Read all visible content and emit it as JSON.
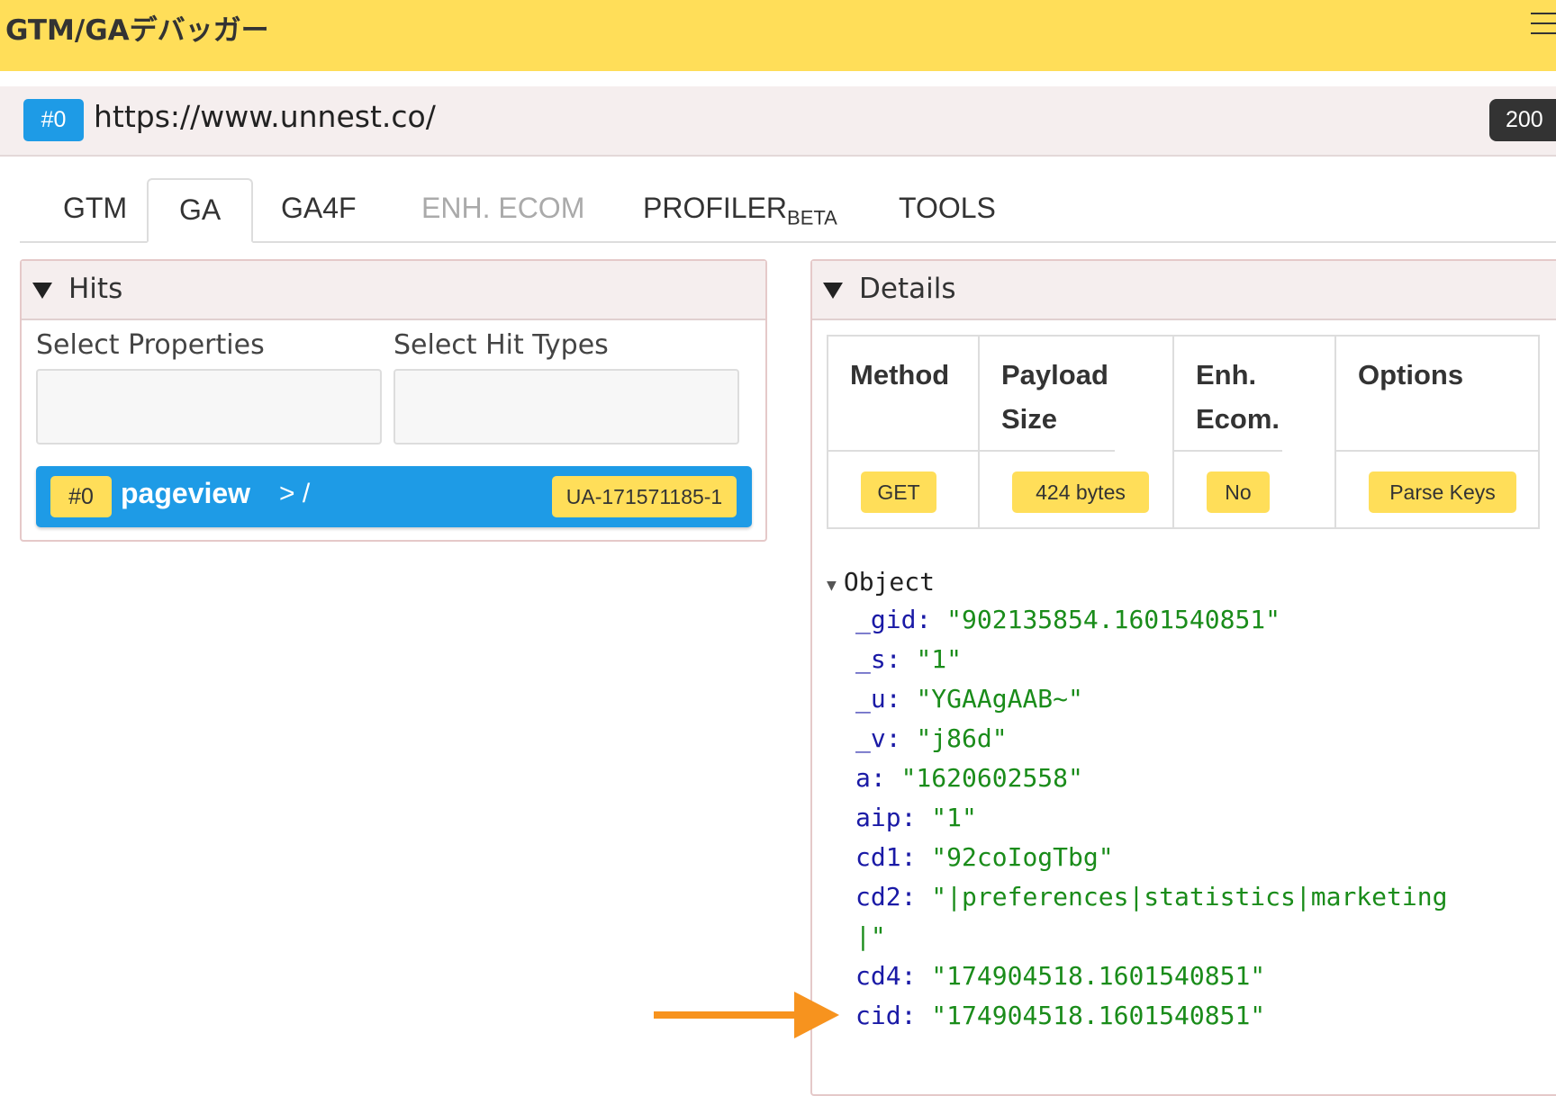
{
  "app": {
    "title": "GTM/GAデバッガー"
  },
  "url_bar": {
    "hit_label": "#0",
    "url": "https://www.unnest.co/",
    "status": "200"
  },
  "tabs": [
    {
      "label": "GTM",
      "sub": "",
      "state": "normal"
    },
    {
      "label": "GA",
      "sub": "",
      "state": "active"
    },
    {
      "label": "GA4F",
      "sub": "",
      "state": "normal"
    },
    {
      "label": "ENH. ECOM",
      "sub": "",
      "state": "disabled"
    },
    {
      "label": "PROFILER",
      "sub": "BETA",
      "state": "normal"
    },
    {
      "label": "TOOLS",
      "sub": "",
      "state": "normal"
    }
  ],
  "hits": {
    "title": "Hits",
    "select_properties_label": "Select Properties",
    "select_hit_types_label": "Select Hit Types",
    "items": [
      {
        "index": "#0",
        "type": "pageview",
        "path": "> /",
        "property": "UA-171571185-1"
      }
    ]
  },
  "details": {
    "title": "Details",
    "headers": {
      "method": "Method",
      "payload": "Payload Size",
      "ecom": "Enh. Ecom.",
      "options": "Options"
    },
    "values": {
      "method": "GET",
      "payload": "424 bytes",
      "ecom": "No",
      "options": "Parse Keys"
    },
    "object_label": "Object",
    "properties": [
      {
        "key": "_gid:",
        "value": "\"902135854.1601540851\""
      },
      {
        "key": "_s:",
        "value": "\"1\""
      },
      {
        "key": "_u:",
        "value": "\"YGAAgAAB~\""
      },
      {
        "key": "_v:",
        "value": "\"j86d\""
      },
      {
        "key": "a:",
        "value": "\"1620602558\""
      },
      {
        "key": "aip:",
        "value": "\"1\""
      },
      {
        "key": "cd1:",
        "value": "\"92coIogTbg\""
      },
      {
        "key": "cd2:",
        "value": "\"|preferences|statistics|marketing",
        "cont": "|\""
      },
      {
        "key": "cd4:",
        "value": "\"174904518.1601540851\""
      },
      {
        "key": "cid:",
        "value": "\"174904518.1601540851\""
      }
    ]
  },
  "colors": {
    "accent": "#ffde59",
    "primary": "#1e9be6",
    "arrow": "#f7931e"
  }
}
